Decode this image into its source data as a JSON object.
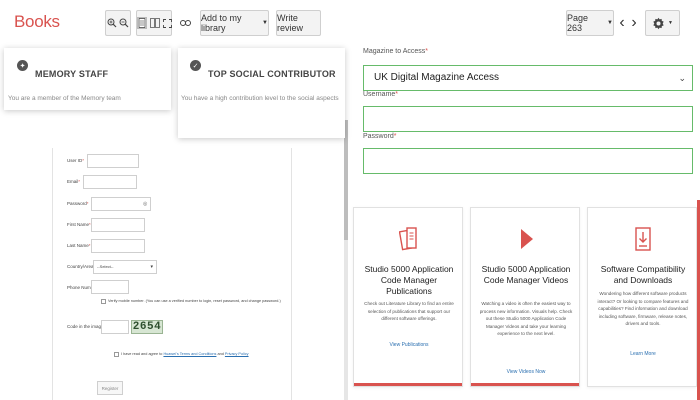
{
  "app": {
    "title": "Books"
  },
  "toolbar": {
    "add_to_library": "Add to my library",
    "write_review": "Write review",
    "page_label": "Page 263",
    "icons": [
      "zoom-in-icon",
      "zoom-out-icon",
      "single-page-icon",
      "double-page-icon",
      "fullscreen-icon",
      "link-icon",
      "chevron-left-icon",
      "chevron-right-icon",
      "gear-icon"
    ]
  },
  "badges": [
    {
      "title": "MEMORY STAFF",
      "text": "You are a member of the Memory team"
    },
    {
      "title": "TOP SOCIAL CONTRIBUTOR",
      "text": "You have a high contribution level to the social aspects"
    }
  ],
  "registration": {
    "fields": [
      "User ID",
      "Email",
      "Password",
      "First Name",
      "Last Name",
      "Country/Area",
      "Phone Number"
    ],
    "country_value": "--Select--",
    "mobile_note": "Verify mobile number. (You can use a verified number to login, reset password, and change password.)",
    "captcha_label": "Code in the image",
    "captcha_value": "2654",
    "agree_prefix": "I have read and agree to",
    "terms_link": "Huawei's Terms and Conditions",
    "agree_and": "and",
    "privacy_link": "Privacy Policy",
    "register_button": "Register"
  },
  "login": {
    "magazine_label": "Magazine to Access",
    "magazine_value": "UK Digital Magazine Access",
    "username_label": "Username",
    "password_label": "Password"
  },
  "resources": [
    {
      "title": "Studio 5000 Application Code Manager Publications",
      "desc": "Check out Literature Library to find an entire selection of publications that support our different software offerings.",
      "link": "View Publications",
      "icon": "documents-icon"
    },
    {
      "title": "Studio 5000 Application Code Manager Videos",
      "desc": "Watching a video is often the easiest way to process new information. Visuals help. Check out these Studio 5000 Application Code Manager Videos and take your learning experience to the next level.",
      "link": "View Videos Now",
      "icon": "play-icon"
    },
    {
      "title": "Software Compatibility and Downloads",
      "desc": "Wondering how different software products interact? Or looking to compare features and capabilities? Find information and download including software, firmware, release notes, drivers and tools.",
      "link": "Learn More",
      "icon": "download-file-icon"
    }
  ],
  "colors": {
    "brand_red": "#d9534f",
    "input_green": "#66bb6a",
    "link_blue": "#2a6fb0"
  }
}
